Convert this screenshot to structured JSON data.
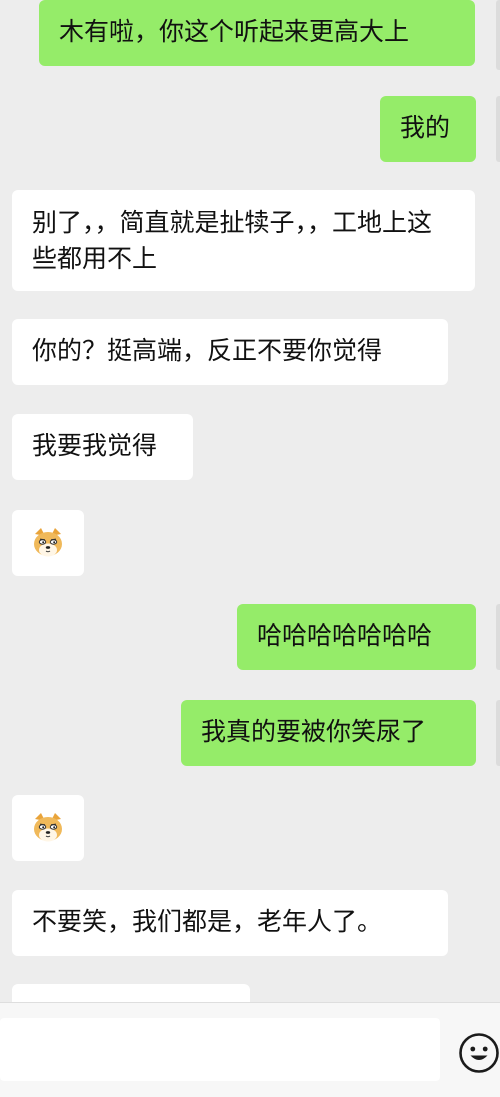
{
  "chat": {
    "messages": [
      {
        "text": "木有啦，你这个听起来更高大上"
      },
      {
        "text": "我的"
      },
      {
        "text": "别了，，简直就是扯犊子，，工地上这些都用不上"
      },
      {
        "text": "你的？挺高端，反正不要你觉得"
      },
      {
        "text": "我要我觉得"
      },
      {
        "text": "哈哈哈哈哈哈哈"
      },
      {
        "text": "我真的要被你笑尿了"
      },
      {
        "text": "不要笑，我们都是，老年人了。"
      }
    ],
    "emoji_1": "doge-icon",
    "emoji_2": "doge-icon"
  },
  "composer": {
    "input_value": ""
  },
  "colors": {
    "outgoing": "#95ec69",
    "incoming": "#ffffff",
    "background": "#ededed"
  }
}
